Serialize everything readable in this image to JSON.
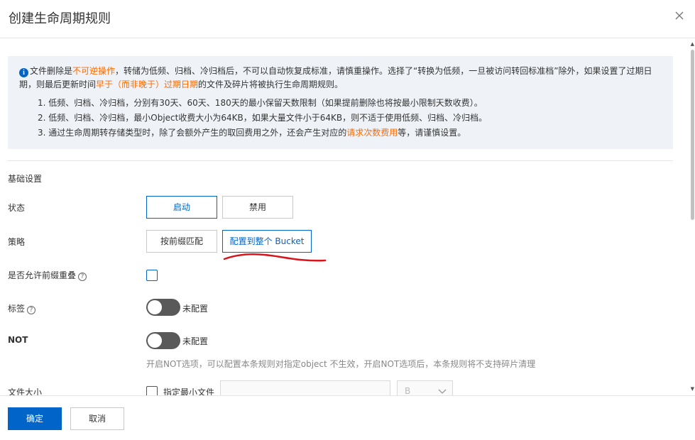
{
  "dialog": {
    "title": "创建生命周期规则"
  },
  "notice": {
    "p1_a": "文件删除是",
    "p1_hl": "不可逆操作",
    "p1_b": "，转储为低频、归档、冷归档后，不可以自动恢复成标准，请慎重操作。选择了“转换为低频，一旦被访问转回标准档”除外，如果设置了过期日期，则最后更新时间",
    "p1_hl2": "早于（而非晚于）过期日期",
    "p1_c": "的文件及碎片将被执行生命周期规则。",
    "item1": "1. 低频、归档、冷归档，分别有30天、60天、180天的最小保留天数限制（如果提前删除也将按最小限制天数收费）。",
    "item2": "2. 低频、归档、冷归档，最小Object收费大小为64KB，如果大量文件小于64KB，则不适于使用低频、归档、冷归档。",
    "item3_a": "3. 通过生命周期转存储类型时，除了会额外产生的取回费用之外，还会产生对应的",
    "item3_hl": "请求次数费用",
    "item3_b": "等，请谨慎设置。"
  },
  "basic": {
    "section_title": "基础设置",
    "status_label": "状态",
    "status_enable": "启动",
    "status_disable": "禁用",
    "policy_label": "策略",
    "policy_prefix": "按前缀匹配",
    "policy_bucket": "配置到整个 Bucket",
    "overlap_label": "是否允许前缀重叠",
    "tag_label": "标签",
    "tag_state": "未配置",
    "not_label": "NOT",
    "not_state": "未配置",
    "not_hint": "开启NOT选项，可以配置本条规则对指定object 不生效，开启NOT选项后，本条规则将不支持碎片清理",
    "size_label": "文件大小",
    "min_size_label": "指定最小文件",
    "unit": "B"
  },
  "footer": {
    "confirm": "确定",
    "cancel": "取消"
  },
  "colors": {
    "primary": "#0064c8",
    "highlight": "#ff6a00",
    "annotation": "#d8141c"
  }
}
